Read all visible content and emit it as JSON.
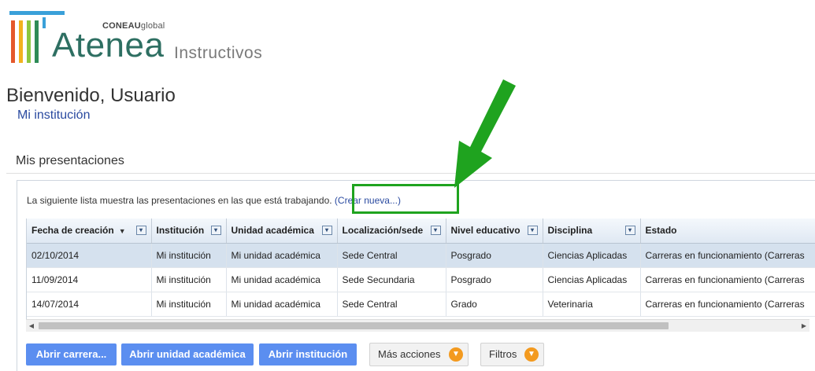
{
  "header": {
    "brand_small": "CONEAU",
    "brand_small_suffix": "global",
    "app_name": "Atenea",
    "subtitle": "Instructivos"
  },
  "welcome": "Bienvenido, Usuario",
  "institution_link": "Mi institución",
  "section_title": "Mis presentaciones",
  "intro": {
    "text": "La siguiente lista muestra las presentaciones en las que está trabajando.",
    "link": "(Crear nueva...)"
  },
  "table": {
    "columns": [
      {
        "label": "Fecha de creación",
        "sorted": "desc"
      },
      {
        "label": "Institución"
      },
      {
        "label": "Unidad académica"
      },
      {
        "label": "Localización/sede"
      },
      {
        "label": "Nivel educativo"
      },
      {
        "label": "Disciplina"
      },
      {
        "label": "Estado"
      }
    ],
    "rows": [
      {
        "fecha": "02/10/2014",
        "institucion": "Mi institución",
        "unidad": "Mi unidad académica",
        "sede": "Sede Central",
        "nivel": "Posgrado",
        "disciplina": "Ciencias Aplicadas",
        "estado": "Carreras en funcionamiento (Carreras"
      },
      {
        "fecha": "11/09/2014",
        "institucion": "Mi institución",
        "unidad": "Mi unidad académica",
        "sede": "Sede Secundaria",
        "nivel": "Posgrado",
        "disciplina": "Ciencias Aplicadas",
        "estado": "Carreras en funcionamiento (Carreras"
      },
      {
        "fecha": "14/07/2014",
        "institucion": "Mi institución",
        "unidad": "Mi unidad académica",
        "sede": "Sede Central",
        "nivel": "Grado",
        "disciplina": "Veterinaria",
        "estado": "Carreras en funcionamiento (Carreras"
      }
    ]
  },
  "actions": {
    "open_career": "Abrir carrera...",
    "open_unit": "Abrir unidad académica",
    "open_institution": "Abrir institución",
    "more_actions": "Más acciones",
    "filters": "Filtros"
  },
  "colors": {
    "brand_green": "#2e6f62",
    "link_blue": "#2a4aa0",
    "button_blue": "#5b8ef0",
    "accent_orange": "#f39a1f",
    "annotation_green": "#1fa31f",
    "selected_row": "#d5e1ee"
  },
  "icons": {
    "sort": "sort-desc-icon",
    "column_filter": "chevron-down-icon",
    "dropdown": "chevron-down-circle-icon",
    "annotation": "arrow-pointer-icon"
  }
}
